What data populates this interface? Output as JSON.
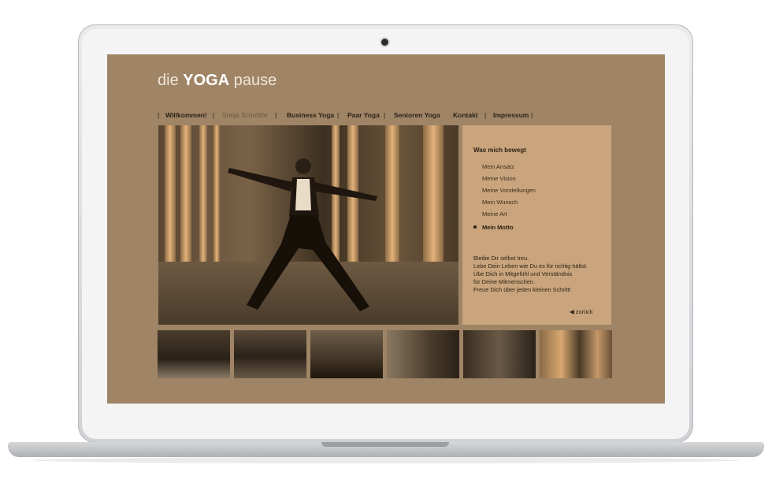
{
  "logo": {
    "prefix": "die",
    "brand": "YOGA",
    "suffix": "pause"
  },
  "nav": {
    "separator": "|",
    "items": [
      {
        "label": "Willkommen!"
      },
      {
        "label": "Sonja Schröttle"
      },
      {
        "label": "Business Yoga"
      },
      {
        "label": "Paar Yoga"
      },
      {
        "label": "Senioren Yoga"
      },
      {
        "label": "Kontakt"
      },
      {
        "label": "Impressum"
      }
    ]
  },
  "panel": {
    "title": "Was mich bewegt",
    "menu": [
      "Mein Ansatz",
      "Meine Vision",
      "Meine Vorstellungen",
      "Mein Wunsch",
      "Meine Art",
      "Mein Motto"
    ],
    "active_index": 5,
    "motto_lines": [
      "Bleibe Dir selbst treu.",
      "Lebe Dein Leben wie Du es für richtig hältst.",
      "Übe Dich in Mitgefühl und Verständnis",
      "für Deine Mitmenschen.",
      "Freue Dich über jeden kleinen Schritt!"
    ],
    "back_label": "zurück"
  },
  "thumbnails": 6,
  "colors": {
    "screen_bg": "#9f8466",
    "panel_bg": "#c9a47c",
    "text_dark": "#2c2217"
  }
}
